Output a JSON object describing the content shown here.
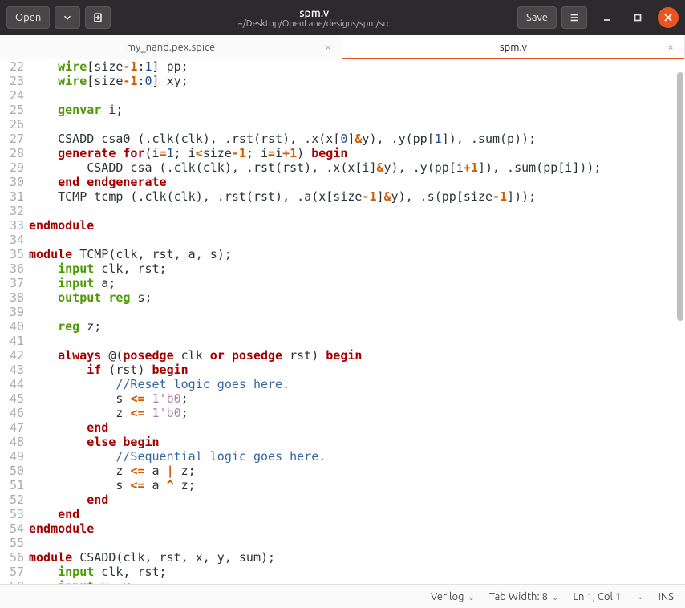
{
  "window": {
    "open_label": "Open",
    "save_label": "Save",
    "title": "spm.v",
    "subtitle": "~/Desktop/OpenLane/designs/spm/src"
  },
  "tabs": [
    {
      "label": "my_nand.pex.spice",
      "active": false
    },
    {
      "label": "spm.v",
      "active": true
    }
  ],
  "code": {
    "first_line": 22,
    "lines": [
      [
        [
          "    ",
          "txt"
        ],
        [
          "wire",
          "kw"
        ],
        [
          "[size",
          "txt"
        ],
        [
          "-1",
          "op"
        ],
        [
          ":",
          "txt"
        ],
        [
          "1",
          "idx"
        ],
        [
          "] pp;",
          "txt"
        ]
      ],
      [
        [
          "    ",
          "txt"
        ],
        [
          "wire",
          "kw"
        ],
        [
          "[size",
          "txt"
        ],
        [
          "-1",
          "op"
        ],
        [
          ":",
          "txt"
        ],
        [
          "0",
          "idx"
        ],
        [
          "] xy;",
          "txt"
        ]
      ],
      [],
      [
        [
          "    ",
          "txt"
        ],
        [
          "genvar",
          "kw"
        ],
        [
          " i;",
          "txt"
        ]
      ],
      [],
      [
        [
          "    CSADD csa0 (.clk(clk), .rst(rst), .x(x[",
          "txt"
        ],
        [
          "0",
          "idx"
        ],
        [
          "]",
          "txt"
        ],
        [
          "&",
          "op"
        ],
        [
          "y), .y(pp[",
          "txt"
        ],
        [
          "1",
          "idx"
        ],
        [
          "]), .sum(p));",
          "txt"
        ]
      ],
      [
        [
          "    ",
          "txt"
        ],
        [
          "generate",
          "kr"
        ],
        [
          " ",
          "txt"
        ],
        [
          "for",
          "kr"
        ],
        [
          "(i",
          "txt"
        ],
        [
          "=",
          "op"
        ],
        [
          "1",
          "num"
        ],
        [
          "; i",
          "txt"
        ],
        [
          "<",
          "op"
        ],
        [
          "size",
          "txt"
        ],
        [
          "-1",
          "op"
        ],
        [
          "; i",
          "txt"
        ],
        [
          "=",
          "op"
        ],
        [
          "i",
          "txt"
        ],
        [
          "+1",
          "op"
        ],
        [
          ") ",
          "txt"
        ],
        [
          "begin",
          "kr"
        ]
      ],
      [
        [
          "        CSADD csa (.clk(clk), .rst(rst), .x(x[i]",
          "txt"
        ],
        [
          "&",
          "op"
        ],
        [
          "y), .y(pp[i",
          "txt"
        ],
        [
          "+1",
          "op"
        ],
        [
          "]), .sum(pp[i]));",
          "txt"
        ]
      ],
      [
        [
          "    ",
          "txt"
        ],
        [
          "end",
          "kr"
        ],
        [
          " ",
          "txt"
        ],
        [
          "endgenerate",
          "kr"
        ]
      ],
      [
        [
          "    TCMP tcmp (.clk(clk), .rst(rst), .a(x[size",
          "txt"
        ],
        [
          "-1",
          "op"
        ],
        [
          "]",
          "txt"
        ],
        [
          "&",
          "op"
        ],
        [
          "y), .s(pp[size",
          "txt"
        ],
        [
          "-1",
          "op"
        ],
        [
          "]));",
          "txt"
        ]
      ],
      [],
      [
        [
          "endmodule",
          "kr"
        ]
      ],
      [],
      [
        [
          "module",
          "kr"
        ],
        [
          " TCMP(clk, rst, a, s);",
          "txt"
        ]
      ],
      [
        [
          "    ",
          "txt"
        ],
        [
          "input",
          "kw"
        ],
        [
          " clk, rst;",
          "txt"
        ]
      ],
      [
        [
          "    ",
          "txt"
        ],
        [
          "input",
          "kw"
        ],
        [
          " a;",
          "txt"
        ]
      ],
      [
        [
          "    ",
          "txt"
        ],
        [
          "output",
          "kw"
        ],
        [
          " ",
          "txt"
        ],
        [
          "reg",
          "kw"
        ],
        [
          " s;",
          "txt"
        ]
      ],
      [],
      [
        [
          "    ",
          "txt"
        ],
        [
          "reg",
          "kw"
        ],
        [
          " z;",
          "txt"
        ]
      ],
      [],
      [
        [
          "    ",
          "txt"
        ],
        [
          "always",
          "kr"
        ],
        [
          " @(",
          "txt"
        ],
        [
          "posedge",
          "kr"
        ],
        [
          " clk ",
          "txt"
        ],
        [
          "or",
          "kr"
        ],
        [
          " ",
          "txt"
        ],
        [
          "posedge",
          "kr"
        ],
        [
          " rst) ",
          "txt"
        ],
        [
          "begin",
          "kr"
        ]
      ],
      [
        [
          "        ",
          "txt"
        ],
        [
          "if",
          "kr"
        ],
        [
          " (rst) ",
          "txt"
        ],
        [
          "begin",
          "kr"
        ]
      ],
      [
        [
          "            ",
          "txt"
        ],
        [
          "//Reset logic goes here.",
          "cmt"
        ]
      ],
      [
        [
          "            s ",
          "txt"
        ],
        [
          "<=",
          "op"
        ],
        [
          " ",
          "txt"
        ],
        [
          "1'b0",
          "lit"
        ],
        [
          ";",
          "txt"
        ]
      ],
      [
        [
          "            z ",
          "txt"
        ],
        [
          "<=",
          "op"
        ],
        [
          " ",
          "txt"
        ],
        [
          "1'b0",
          "lit"
        ],
        [
          ";",
          "txt"
        ]
      ],
      [
        [
          "        ",
          "txt"
        ],
        [
          "end",
          "kr"
        ]
      ],
      [
        [
          "        ",
          "txt"
        ],
        [
          "else",
          "kr"
        ],
        [
          " ",
          "txt"
        ],
        [
          "begin",
          "kr"
        ]
      ],
      [
        [
          "            ",
          "txt"
        ],
        [
          "//Sequential logic goes here.",
          "cmt"
        ]
      ],
      [
        [
          "            z ",
          "txt"
        ],
        [
          "<=",
          "op"
        ],
        [
          " a ",
          "txt"
        ],
        [
          "|",
          "op"
        ],
        [
          " z;",
          "txt"
        ]
      ],
      [
        [
          "            s ",
          "txt"
        ],
        [
          "<=",
          "op"
        ],
        [
          " a ",
          "txt"
        ],
        [
          "^",
          "op"
        ],
        [
          " z;",
          "txt"
        ]
      ],
      [
        [
          "        ",
          "txt"
        ],
        [
          "end",
          "kr"
        ]
      ],
      [
        [
          "    ",
          "txt"
        ],
        [
          "end",
          "kr"
        ]
      ],
      [
        [
          "endmodule",
          "kr"
        ]
      ],
      [],
      [
        [
          "module",
          "kr"
        ],
        [
          " CSADD(clk, rst, x, y, sum);",
          "txt"
        ]
      ],
      [
        [
          "    ",
          "txt"
        ],
        [
          "input",
          "kw"
        ],
        [
          " clk, rst;",
          "txt"
        ]
      ],
      [
        [
          "    ",
          "txt"
        ],
        [
          "input",
          "kw"
        ],
        [
          " x, y;",
          "txt"
        ]
      ]
    ]
  },
  "status": {
    "language": "Verilog",
    "tab_width": "Tab Width: 8",
    "cursor": "Ln 1, Col 1",
    "mode": "INS"
  }
}
